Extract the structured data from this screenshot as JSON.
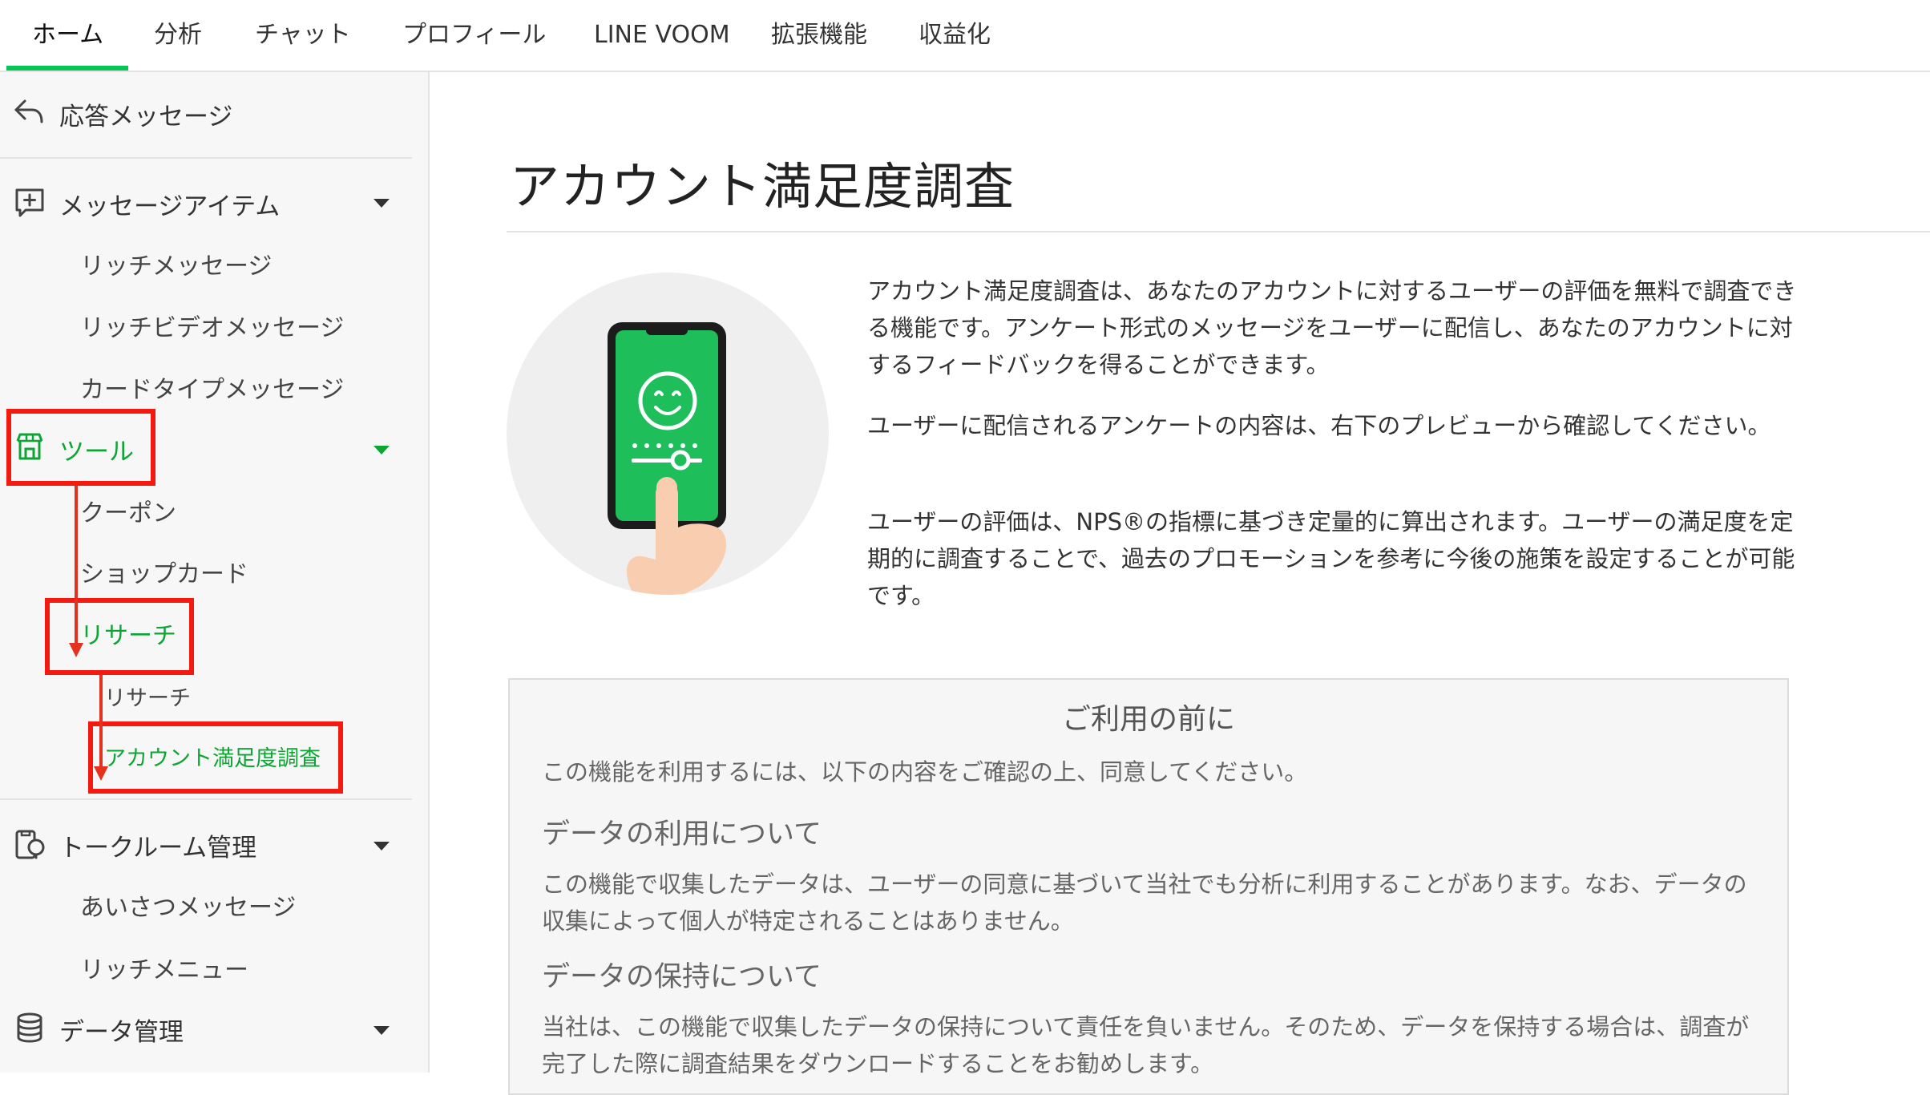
{
  "top_nav": {
    "tabs": [
      {
        "label": "ホーム",
        "active": true
      },
      {
        "label": "分析"
      },
      {
        "label": "チャット"
      },
      {
        "label": "プロフィール"
      },
      {
        "label": "LINE VOOM"
      },
      {
        "label": "拡張機能"
      },
      {
        "label": "収益化"
      }
    ]
  },
  "sidebar": {
    "auto_reply": "応答メッセージ",
    "message_items": {
      "label": "メッセージアイテム",
      "children": [
        "リッチメッセージ",
        "リッチビデオメッセージ",
        "カードタイプメッセージ"
      ]
    },
    "tools": {
      "label": "ツール",
      "children": [
        "クーポン",
        "ショップカード"
      ],
      "research": {
        "label": "リサーチ",
        "children": [
          "リサーチ",
          "アカウント満足度調査"
        ]
      }
    },
    "talkroom": {
      "label": "トークルーム管理",
      "children": [
        "あいさつメッセージ",
        "リッチメニュー"
      ]
    },
    "data_management": {
      "label": "データ管理"
    }
  },
  "main": {
    "title": "アカウント満足度調査",
    "description": [
      "アカウント満足度調査は、あなたのアカウントに対するユーザーの評価を無料で調査できる機能です。アンケート形式のメッセージをユーザーに配信し、あなたのアカウントに対するフィードバックを得ることができます。",
      "ユーザーに配信されるアンケートの内容は、右下のプレビューから確認してください。",
      "ユーザーの評価は、NPS®の指標に基づき定量的に算出されます。ユーザーの満足度を定期的に調査することで、過去のプロモーションを参考に今後の施策を設定することが可能です。"
    ],
    "notice": {
      "title": "ご利用の前に",
      "intro": "この機能を利用するには、以下の内容をご確認の上、同意してください。",
      "sections": [
        {
          "heading": "データの利用について",
          "body": "この機能で収集したデータは、ユーザーの同意に基づいて当社でも分析に利用することがあります。なお、データの収集によって個人が特定されることはありません。"
        },
        {
          "heading": "データの保持について",
          "body": "当社は、この機能で収集したデータの保持について責任を負いません。そのため、データを保持する場合は、調査が完了した際に調査結果をダウンロードすることをお勧めします。"
        }
      ]
    }
  },
  "colors": {
    "brand_green": "#06c755",
    "active_text": "#0ea534",
    "highlight_red": "#f41a0f"
  }
}
